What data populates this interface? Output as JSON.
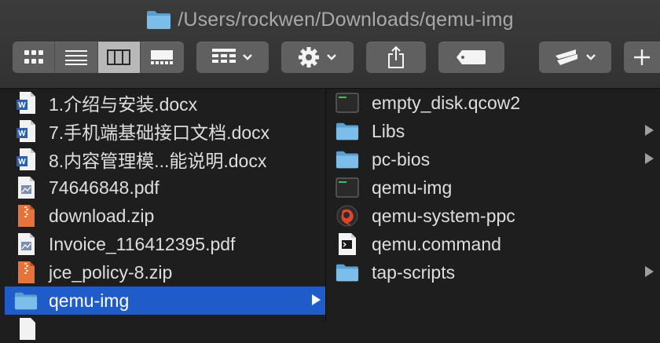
{
  "window": {
    "path_title": "/Users/rockwen/Downloads/qemu-img"
  },
  "toolbar": {
    "view_modes": [
      "icon-view",
      "list-view",
      "column-view",
      "gallery-view"
    ],
    "active_view": "column-view",
    "buttons": [
      "group-by",
      "action",
      "share",
      "edit-tags",
      "custom",
      "add"
    ]
  },
  "left_column": {
    "items": [
      {
        "name": "1.介绍与安装.docx",
        "icon": "word-doc-icon"
      },
      {
        "name": "7.手机端基础接口文档.docx",
        "icon": "word-doc-icon"
      },
      {
        "name": "8.内容管理模...能说明.docx",
        "icon": "word-doc-icon"
      },
      {
        "name": "74646848.pdf",
        "icon": "pdf-icon"
      },
      {
        "name": "download.zip",
        "icon": "zip-icon"
      },
      {
        "name": "Invoice_116412395.pdf",
        "icon": "pdf-icon"
      },
      {
        "name": "jce_policy-8.zip",
        "icon": "zip-icon"
      },
      {
        "name": "qemu-img",
        "icon": "folder-icon",
        "selected": true
      }
    ]
  },
  "right_column": {
    "items": [
      {
        "name": "empty_disk.qcow2",
        "icon": "terminal-exec-icon"
      },
      {
        "name": "Libs",
        "icon": "folder-icon"
      },
      {
        "name": "pc-bios",
        "icon": "folder-icon"
      },
      {
        "name": "qemu-img",
        "icon": "terminal-exec-icon"
      },
      {
        "name": "qemu-system-ppc",
        "icon": "qemu-app-icon"
      },
      {
        "name": "qemu.command",
        "icon": "command-script-icon"
      },
      {
        "name": "tap-scripts",
        "icon": "folder-icon"
      }
    ]
  },
  "colors": {
    "selection": "#1f5bc9",
    "folder": "#6db3e6",
    "toolbar_button": "#606060"
  }
}
